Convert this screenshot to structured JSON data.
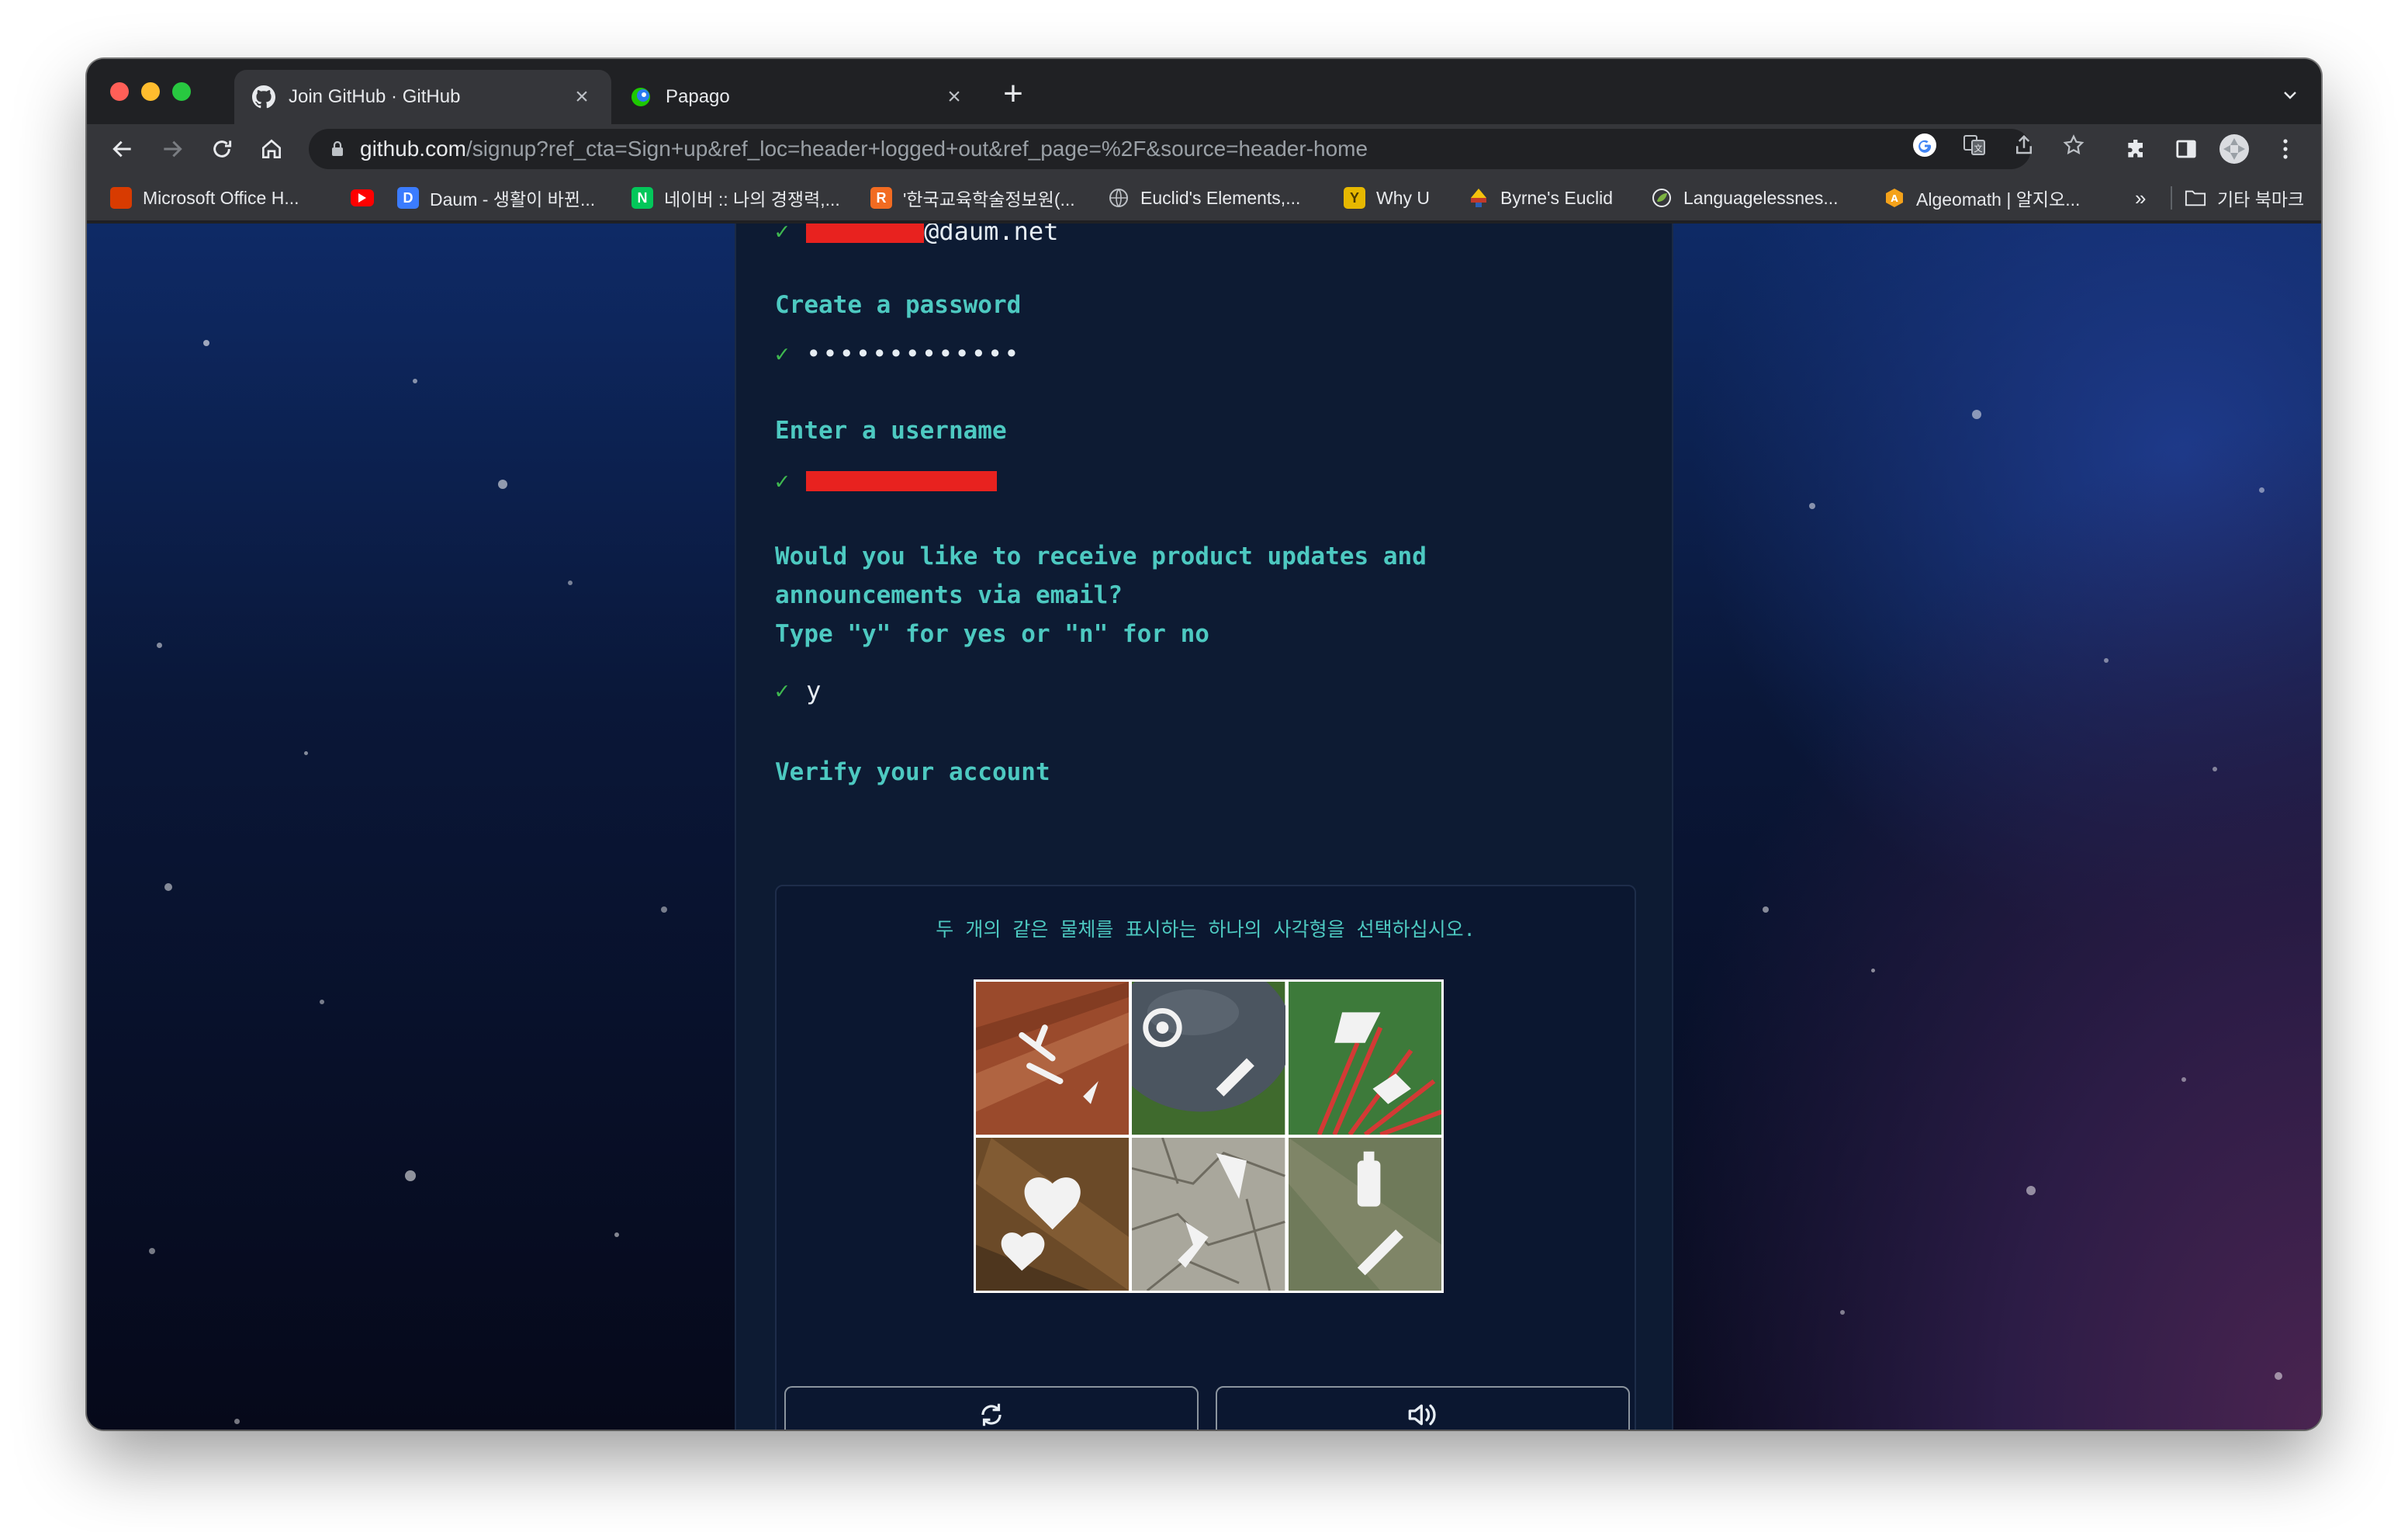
{
  "browser": {
    "tabs": [
      {
        "title": "Join GitHub · GitHub",
        "active": true,
        "icon": "github-icon"
      },
      {
        "title": "Papago",
        "active": false,
        "icon": "papago-icon"
      }
    ],
    "address": {
      "host": "github.com",
      "path": "/signup?ref_cta=Sign+up&ref_loc=header+logged+out&ref_page=%2F&source=header-home"
    },
    "bookmarks": [
      {
        "label": "Microsoft Office H...",
        "icon": "office-icon",
        "color": "#d83b01"
      },
      {
        "label": "",
        "icon": "youtube-icon",
        "color": "#ff0000"
      },
      {
        "label": "Daum - 생활이 바뀐...",
        "icon": "daum-icon",
        "color": "#3b7cff"
      },
      {
        "label": "네이버 :: 나의 경쟁력,...",
        "icon": "naver-icon",
        "color": "#03c75a"
      },
      {
        "label": "'한국교육학술정보원(...",
        "icon": "riss-icon",
        "color": "#f26b21"
      },
      {
        "label": "Euclid's Elements,...",
        "icon": "globe-icon",
        "color": "#9aa0a6"
      },
      {
        "label": "Why U",
        "icon": "whyu-icon",
        "color": "#e6b800"
      },
      {
        "label": "Byrne's Euclid",
        "icon": "byrne-icon",
        "color": "#c0392b"
      },
      {
        "label": "Languagelessnes...",
        "icon": "leaf-icon",
        "color": "#7cb342"
      },
      {
        "label": "Algeomath | 알지오...",
        "icon": "algeomath-icon",
        "color": "#f4a21a"
      }
    ],
    "more_bookmarks": "»",
    "other_bookmarks": "기타 북마크"
  },
  "signup": {
    "email_value": "@daum.net",
    "password_label": "Create a password",
    "password_value": "•••••••••••••",
    "username_label": "Enter a username",
    "updates_lines": [
      "Would you like to receive product updates and",
      "announcements via email?",
      "Type \"y\" for yes or \"n\" for no"
    ],
    "updates_value": "y",
    "verify_label": "Verify your account"
  },
  "captcha": {
    "instruction": "두 개의 같은 물체를 표시하는 하나의 사각형을 선택하십시오.",
    "cells": [
      {
        "name": "captcha-cell-1",
        "bg": "#9a4a2c"
      },
      {
        "name": "captcha-cell-2",
        "bg": "#4a5a3a"
      },
      {
        "name": "captcha-cell-3",
        "bg": "#3d7a3a"
      },
      {
        "name": "captcha-cell-4",
        "bg": "#7a5530"
      },
      {
        "name": "captcha-cell-5",
        "bg": "#a9a79c"
      },
      {
        "name": "captcha-cell-6",
        "bg": "#6f7a5a"
      }
    ]
  }
}
